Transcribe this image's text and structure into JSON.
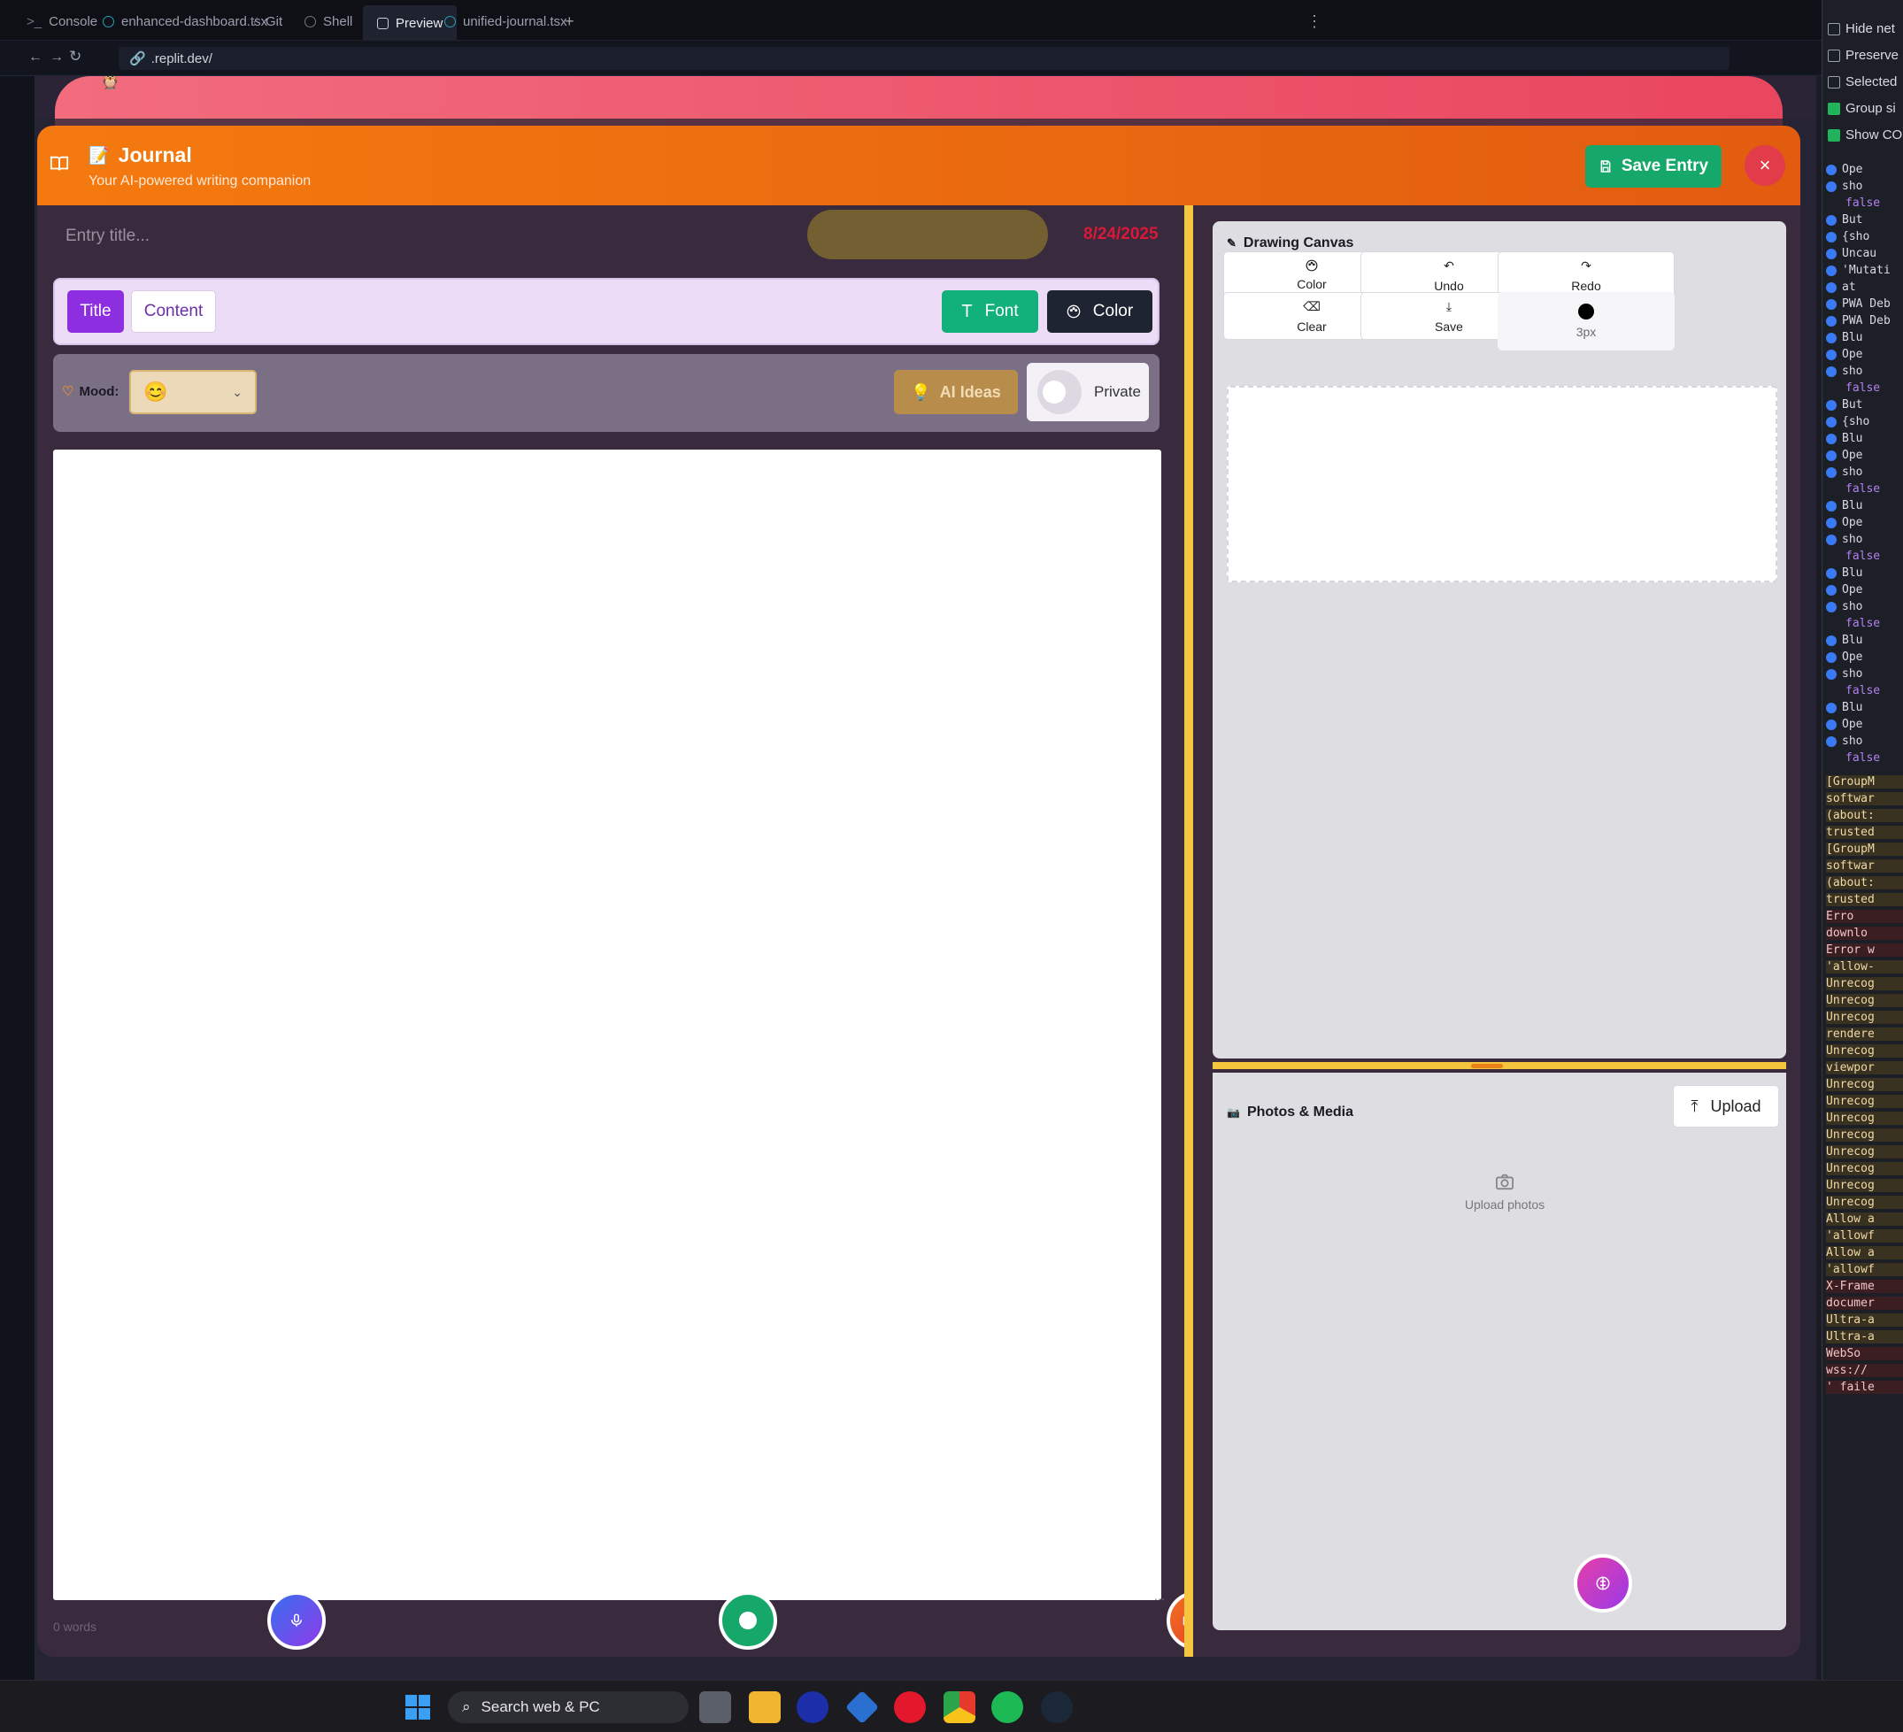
{
  "tabs": [
    {
      "label": "Console"
    },
    {
      "label": "enhanced-dashboard.tsx"
    },
    {
      "label": "Git"
    },
    {
      "label": "Shell"
    },
    {
      "label": "Preview"
    },
    {
      "label": "unified-journal.tsx"
    }
  ],
  "address": {
    "url": ".replit.dev/"
  },
  "modal": {
    "title": "Journal",
    "subtitle": "Your AI-powered writing companion",
    "save_label": "Save Entry",
    "close_label": "×"
  },
  "entry": {
    "title_placeholder": "Entry title...",
    "date": "8/24/2025",
    "word_count": "0 words"
  },
  "toolbar": {
    "title_label": "Title",
    "content_label": "Content",
    "font_label": "Font",
    "color_label": "Color"
  },
  "mood": {
    "label": "Mood:",
    "selected": "😊",
    "ai_ideas_label": "AI Ideas",
    "private_label": "Private"
  },
  "drawing": {
    "title": "Drawing Canvas",
    "buttons": [
      "Color",
      "Undo",
      "Redo",
      "Clear",
      "Save"
    ],
    "brush_size": "3px"
  },
  "photos": {
    "title": "Photos & Media",
    "upload_label": "Upload",
    "placeholder": "Upload photos"
  },
  "devtools": {
    "options": [
      "Hide net",
      "Preserve",
      "Selected",
      "Group si",
      "Show CO"
    ],
    "logs": [
      "Ope",
      "sho",
      "false",
      "But",
      "{sho",
      "Uncau",
      "'Mutati",
      "at",
      "PWA Deb",
      "PWA Deb",
      "Blu",
      "Ope",
      "sho",
      "false",
      "But",
      "{sho",
      "Blu",
      "Ope",
      "sho",
      "false",
      "Blu",
      "Ope",
      "sho",
      "false",
      "Blu",
      "Ope",
      "sho",
      "false",
      "Blu",
      "Ope",
      "sho",
      "false",
      "Blu",
      "Ope",
      "sho",
      "false"
    ],
    "warnings": [
      "[GroupM",
      "softwar",
      "(about:",
      "trusted",
      "[GroupM",
      "softwar",
      "(about:",
      "trusted",
      "Erro",
      "downlo",
      "Error w",
      "'allow-",
      "Unrecog",
      "Unrecog",
      "Unrecog",
      "rendere",
      "Unrecog",
      "viewpor",
      "Unrecog",
      "Unrecog",
      "Unrecog",
      "Unrecog",
      "Unrecog",
      "Unrecog",
      "Unrecog",
      "Unrecog",
      "Allow a",
      "'allowf",
      "Allow a",
      "'allowf",
      "X-Frame",
      "documer",
      "Ultra-a",
      "Ultra-a",
      "WebSo",
      "wss://",
      "' faile"
    ]
  },
  "taskbar": {
    "search_label": "Search web & PC"
  },
  "colors": {
    "header_orange": "#f47a0f",
    "save_green": "#16a86a",
    "title_purple": "#8d2ee0",
    "date_red": "#d9183a",
    "divider_yellow": "#f5c53d"
  }
}
